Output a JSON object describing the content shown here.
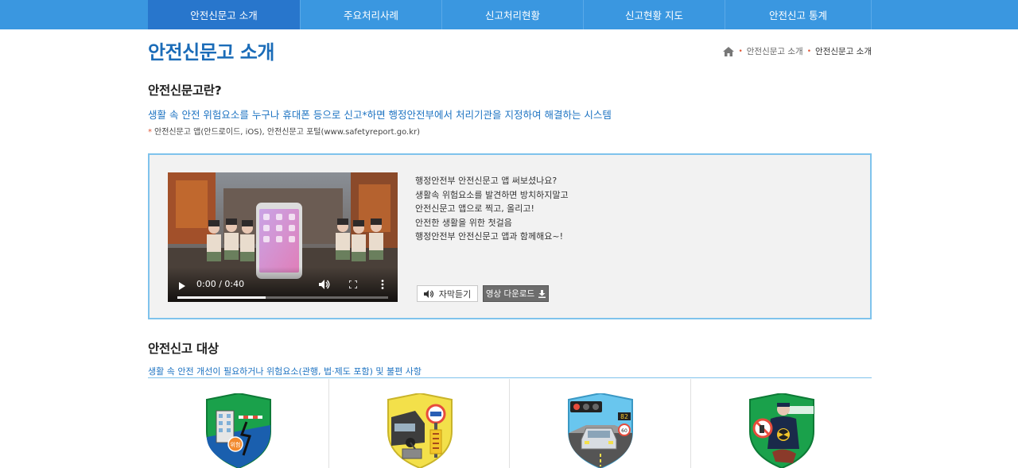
{
  "nav": {
    "items": [
      {
        "label": "안전신문고 소개",
        "active": true
      },
      {
        "label": "주요처리사례",
        "active": false
      },
      {
        "label": "신고처리현황",
        "active": false
      },
      {
        "label": "신고현황 지도",
        "active": false
      },
      {
        "label": "안전신고 통계",
        "active": false
      }
    ]
  },
  "page": {
    "title": "안전신문고 소개"
  },
  "breadcrumb": {
    "home_icon": "home-icon",
    "items": [
      "안전신문고 소개",
      "안전신문고 소개"
    ]
  },
  "section_intro": {
    "title": "안전신문고란?",
    "description": "생활 속 안전 위험요소를 누구나 휴대폰 등으로 신고*하면 행정안전부에서 처리기관을 지정하여 해결하는 시스템",
    "note_mark": "*",
    "note": "안전신문고 앱(안드로이드, iOS), 안전신문고 포털(www.safetyreport.go.kr)"
  },
  "video": {
    "time": "0:00 / 0:40",
    "progress": 0.42,
    "text_lines": [
      "행정안전부 안전신문고 앱 써보셨나요?",
      "생활속 위험요소를 발견하면 방치하지말고",
      "안전신문고 앱으로 찍고, 올리고!",
      "안전한 생활을 위한 첫걸음",
      "행정안전부 안전신문고 앱과 함께해요~!"
    ],
    "audio_button": "자막듣기",
    "download_button": "영상 다운로드"
  },
  "section_targets": {
    "title": "안전신고 대상",
    "description": "생활 속 안전 개선이 필요하거나 위험요소(관행, 법·제도 포함) 및 불편 사항",
    "cards": [
      {
        "icon": "building-hazard-shield-icon",
        "color": "#1aa14b",
        "badge": "위험"
      },
      {
        "icon": "parking-violation-shield-icon",
        "color": "#f3e04a"
      },
      {
        "icon": "traffic-signal-shield-icon",
        "color": "#69c6ee",
        "speed_sign": "82",
        "limit_sign": "60"
      },
      {
        "icon": "prohibited-act-shield-icon",
        "color": "#1aa14b"
      }
    ]
  },
  "colors": {
    "nav_bg": "#3a97e0",
    "nav_active": "#2876cc",
    "title_blue": "#1b6cb8",
    "accent_blue": "#1d73c2",
    "box_border": "#7fc3ec"
  }
}
